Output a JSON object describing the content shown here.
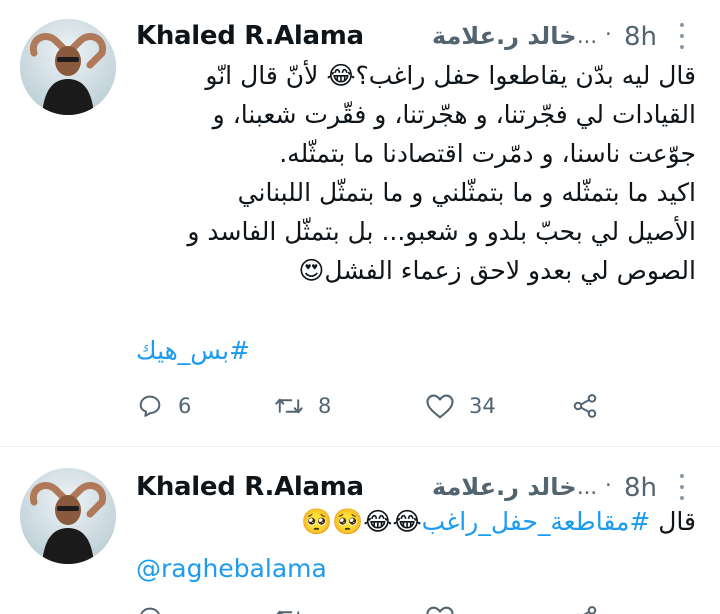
{
  "tweets": [
    {
      "display_name": "Khaled R.Alama",
      "handle": "خالد ر.علامة",
      "ellipsis": "...",
      "separator": "·",
      "time": "8h",
      "lines": [
        "قال ليه بدّن يقاطعوا حفل راغب؟😂 لأنّ قال انّو",
        "القيادات لي فجّرتنا، و هجّرتنا، و فقّرت شعبنا، و",
        "جوّعت ناسنا، و دمّرت اقتصادنا ما بتمثّله.",
        "اكيد ما بتمثّله و ما بتمثّلني و ما بتمثّل اللبناني",
        "الأصيل لي بحبّ بلدو و شعبو... بل بتمثّل الفاسد و",
        "الصوص لي بعدو لاحق زعماء الفشل😍"
      ],
      "hashtag": "#بس_هيك",
      "actions": {
        "replies": "6",
        "retweets": "8",
        "likes": "34"
      }
    },
    {
      "display_name": "Khaled R.Alama",
      "handle": "خالد ر.علامة",
      "ellipsis": "...",
      "separator": "·",
      "time": "8h",
      "text_prefix": "قال ",
      "hashtag": "#مقاطعة_حفل_راغب",
      "emojis": "😂😂🥺🥺",
      "mention": "@raghebalama"
    }
  ],
  "colors": {
    "accent": "#1d9bf0",
    "text": "#0f1419",
    "secondary": "#536471",
    "divider": "#e6ecf0"
  },
  "icons": [
    "reply-icon",
    "retweet-icon",
    "like-icon",
    "share-icon",
    "more-options-icon"
  ]
}
